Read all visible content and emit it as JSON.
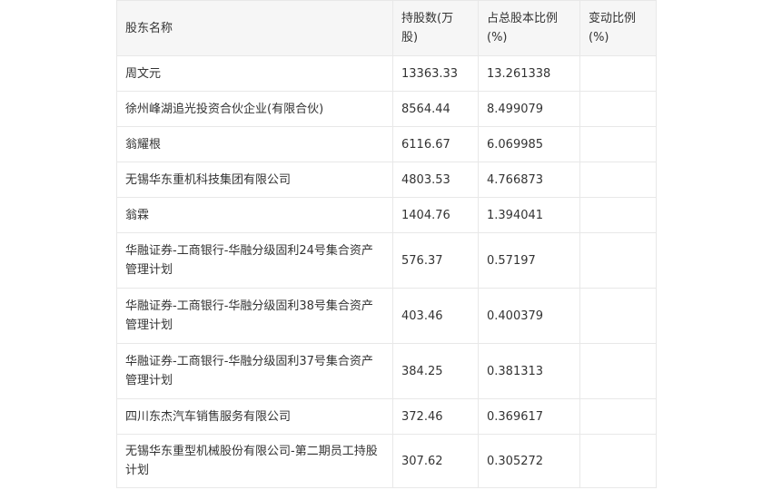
{
  "table": {
    "headers": {
      "name": "股东名称",
      "shares": "持股数(万股)",
      "ratio": "占总股本比例(%)",
      "change": "变动比例(%)"
    },
    "rows": [
      {
        "name": "周文元",
        "shares": "13363.33",
        "ratio": "13.261338",
        "change": ""
      },
      {
        "name": "徐州峰湖追光投资合伙企业(有限合伙)",
        "shares": "8564.44",
        "ratio": "8.499079",
        "change": ""
      },
      {
        "name": "翁耀根",
        "shares": "6116.67",
        "ratio": "6.069985",
        "change": ""
      },
      {
        "name": "无锡华东重机科技集团有限公司",
        "shares": "4803.53",
        "ratio": "4.766873",
        "change": ""
      },
      {
        "name": "翁霖",
        "shares": "1404.76",
        "ratio": "1.394041",
        "change": ""
      },
      {
        "name": "华融证券-工商银行-华融分级固利24号集合资产管理计划",
        "shares": "576.37",
        "ratio": "0.57197",
        "change": ""
      },
      {
        "name": "华融证券-工商银行-华融分级固利38号集合资产管理计划",
        "shares": "403.46",
        "ratio": "0.400379",
        "change": ""
      },
      {
        "name": "华融证券-工商银行-华融分级固利37号集合资产管理计划",
        "shares": "384.25",
        "ratio": "0.381313",
        "change": ""
      },
      {
        "name": "四川东杰汽车销售服务有限公司",
        "shares": "372.46",
        "ratio": "0.369617",
        "change": ""
      },
      {
        "name": "无锡华东重型机械股份有限公司-第二期员工持股计划",
        "shares": "307.62",
        "ratio": "0.305272",
        "change": ""
      }
    ]
  }
}
